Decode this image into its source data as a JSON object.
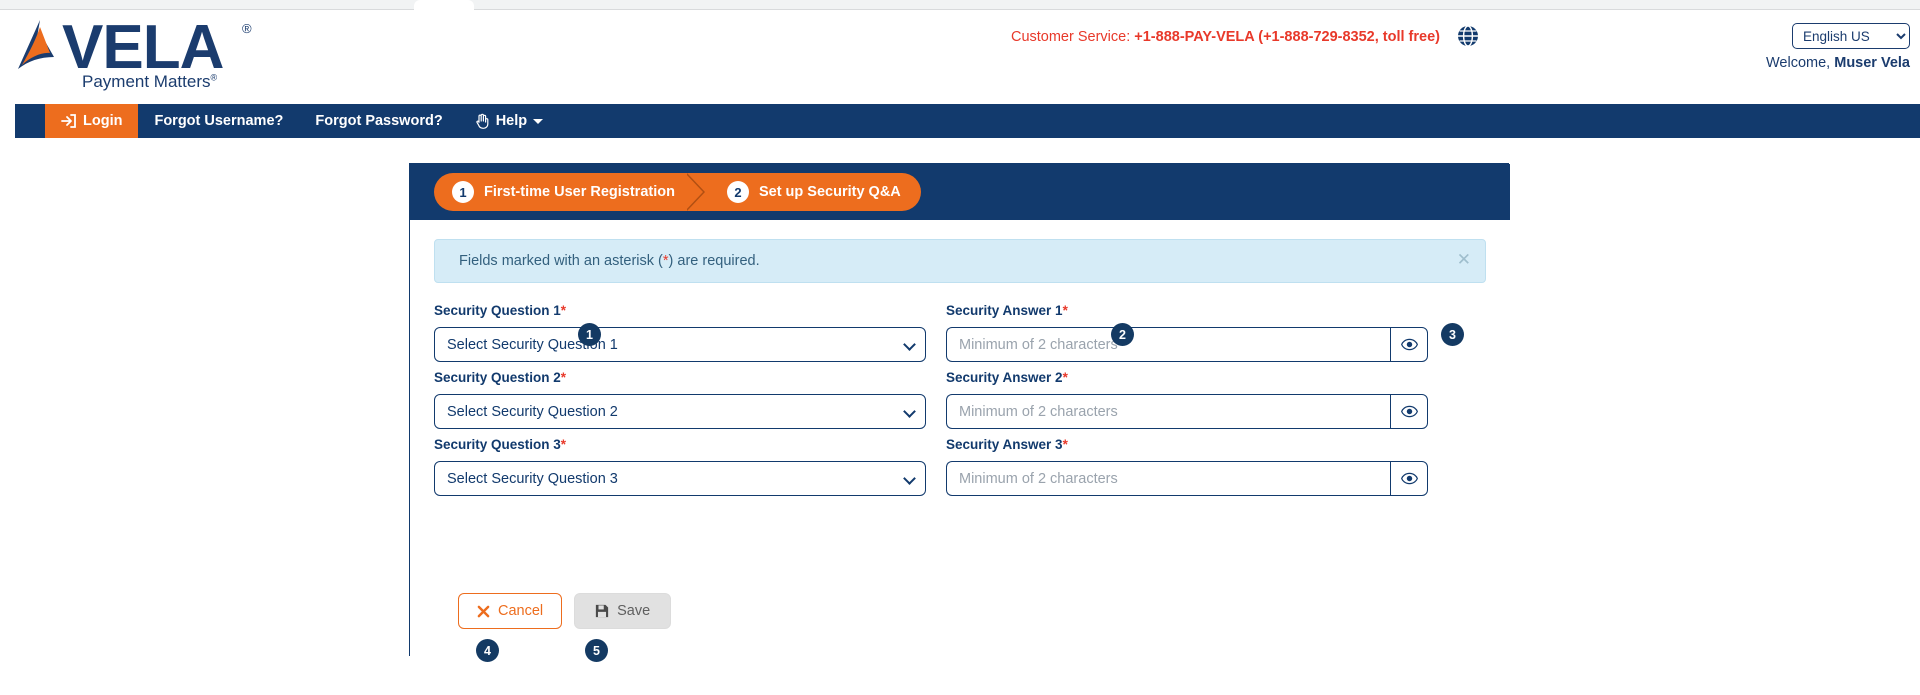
{
  "header": {
    "logo_word": "VELA",
    "logo_registered": "®",
    "tagline": "Payment Matters",
    "tagline_registered": "®",
    "customer_service_label": "Customer Service: ",
    "customer_service_phone": "+1-888-PAY-VELA (+1-888-729-8352, toll free)",
    "globe_icon": "globe-icon",
    "language_selected": "English US",
    "language_options": [
      "English US"
    ],
    "welcome_prefix": "Welcome, ",
    "welcome_name": "Muser Vela"
  },
  "nav": {
    "items": [
      {
        "label": "Login",
        "icon": "login-icon",
        "active": true,
        "has_caret": false
      },
      {
        "label": "Forgot Username?",
        "icon": "",
        "active": false,
        "has_caret": false
      },
      {
        "label": "Forgot Password?",
        "icon": "",
        "active": false,
        "has_caret": false
      },
      {
        "label": "Help",
        "icon": "hand-icon",
        "active": false,
        "has_caret": true
      }
    ]
  },
  "stepper": {
    "steps": [
      {
        "number": "1",
        "label": "First-time User Registration"
      },
      {
        "number": "2",
        "label": "Set up Security Q&A"
      }
    ]
  },
  "alert": {
    "text_before": "Fields marked with an asterisk (",
    "asterisk": "*",
    "text_after": ") are required.",
    "close_icon": "close-icon"
  },
  "form": {
    "rows": [
      {
        "question_label": "Security Question 1",
        "question_required": "*",
        "question_placeholder": "Select Security Question 1",
        "answer_label": "Security Answer 1",
        "answer_required": "*",
        "answer_placeholder": "Minimum of 2 characters",
        "answer_value": "",
        "eye_icon": "eye-icon"
      },
      {
        "question_label": "Security Question 2",
        "question_required": "*",
        "question_placeholder": "Select Security Question 2",
        "answer_label": "Security Answer 2",
        "answer_required": "*",
        "answer_placeholder": "Minimum of 2 characters",
        "answer_value": "",
        "eye_icon": "eye-icon"
      },
      {
        "question_label": "Security Question 3",
        "question_required": "*",
        "question_placeholder": "Select Security Question 3",
        "answer_label": "Security Answer 3",
        "answer_required": "*",
        "answer_placeholder": "Minimum of 2 characters",
        "answer_value": "",
        "eye_icon": "eye-icon"
      }
    ]
  },
  "buttons": {
    "cancel_label": "Cancel",
    "cancel_icon": "x-icon",
    "save_label": "Save",
    "save_icon": "floppy-disk-icon"
  },
  "annotation_badges": [
    "1",
    "2",
    "3",
    "4",
    "5"
  ],
  "colors": {
    "brand_navy": "#123a6d",
    "brand_orange": "#ed6d1e",
    "alert_red": "#e8392a",
    "alert_bg": "#d6ecf7",
    "badge_navy": "#143a63"
  }
}
